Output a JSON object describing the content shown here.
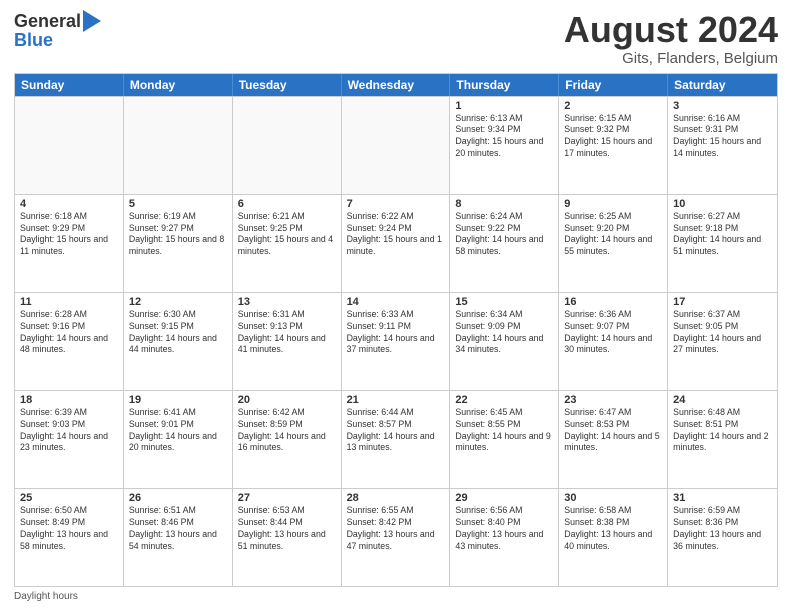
{
  "header": {
    "logo_general": "General",
    "logo_blue": "Blue",
    "title": "August 2024",
    "location": "Gits, Flanders, Belgium"
  },
  "days_of_week": [
    "Sunday",
    "Monday",
    "Tuesday",
    "Wednesday",
    "Thursday",
    "Friday",
    "Saturday"
  ],
  "footer": {
    "note": "Daylight hours"
  },
  "weeks": [
    [
      {
        "day": "",
        "empty": true
      },
      {
        "day": "",
        "empty": true
      },
      {
        "day": "",
        "empty": true
      },
      {
        "day": "",
        "empty": true
      },
      {
        "day": "1",
        "sunrise": "Sunrise: 6:13 AM",
        "sunset": "Sunset: 9:34 PM",
        "daylight": "Daylight: 15 hours and 20 minutes."
      },
      {
        "day": "2",
        "sunrise": "Sunrise: 6:15 AM",
        "sunset": "Sunset: 9:32 PM",
        "daylight": "Daylight: 15 hours and 17 minutes."
      },
      {
        "day": "3",
        "sunrise": "Sunrise: 6:16 AM",
        "sunset": "Sunset: 9:31 PM",
        "daylight": "Daylight: 15 hours and 14 minutes."
      }
    ],
    [
      {
        "day": "4",
        "sunrise": "Sunrise: 6:18 AM",
        "sunset": "Sunset: 9:29 PM",
        "daylight": "Daylight: 15 hours and 11 minutes."
      },
      {
        "day": "5",
        "sunrise": "Sunrise: 6:19 AM",
        "sunset": "Sunset: 9:27 PM",
        "daylight": "Daylight: 15 hours and 8 minutes."
      },
      {
        "day": "6",
        "sunrise": "Sunrise: 6:21 AM",
        "sunset": "Sunset: 9:25 PM",
        "daylight": "Daylight: 15 hours and 4 minutes."
      },
      {
        "day": "7",
        "sunrise": "Sunrise: 6:22 AM",
        "sunset": "Sunset: 9:24 PM",
        "daylight": "Daylight: 15 hours and 1 minute."
      },
      {
        "day": "8",
        "sunrise": "Sunrise: 6:24 AM",
        "sunset": "Sunset: 9:22 PM",
        "daylight": "Daylight: 14 hours and 58 minutes."
      },
      {
        "day": "9",
        "sunrise": "Sunrise: 6:25 AM",
        "sunset": "Sunset: 9:20 PM",
        "daylight": "Daylight: 14 hours and 55 minutes."
      },
      {
        "day": "10",
        "sunrise": "Sunrise: 6:27 AM",
        "sunset": "Sunset: 9:18 PM",
        "daylight": "Daylight: 14 hours and 51 minutes."
      }
    ],
    [
      {
        "day": "11",
        "sunrise": "Sunrise: 6:28 AM",
        "sunset": "Sunset: 9:16 PM",
        "daylight": "Daylight: 14 hours and 48 minutes."
      },
      {
        "day": "12",
        "sunrise": "Sunrise: 6:30 AM",
        "sunset": "Sunset: 9:15 PM",
        "daylight": "Daylight: 14 hours and 44 minutes."
      },
      {
        "day": "13",
        "sunrise": "Sunrise: 6:31 AM",
        "sunset": "Sunset: 9:13 PM",
        "daylight": "Daylight: 14 hours and 41 minutes."
      },
      {
        "day": "14",
        "sunrise": "Sunrise: 6:33 AM",
        "sunset": "Sunset: 9:11 PM",
        "daylight": "Daylight: 14 hours and 37 minutes."
      },
      {
        "day": "15",
        "sunrise": "Sunrise: 6:34 AM",
        "sunset": "Sunset: 9:09 PM",
        "daylight": "Daylight: 14 hours and 34 minutes."
      },
      {
        "day": "16",
        "sunrise": "Sunrise: 6:36 AM",
        "sunset": "Sunset: 9:07 PM",
        "daylight": "Daylight: 14 hours and 30 minutes."
      },
      {
        "day": "17",
        "sunrise": "Sunrise: 6:37 AM",
        "sunset": "Sunset: 9:05 PM",
        "daylight": "Daylight: 14 hours and 27 minutes."
      }
    ],
    [
      {
        "day": "18",
        "sunrise": "Sunrise: 6:39 AM",
        "sunset": "Sunset: 9:03 PM",
        "daylight": "Daylight: 14 hours and 23 minutes."
      },
      {
        "day": "19",
        "sunrise": "Sunrise: 6:41 AM",
        "sunset": "Sunset: 9:01 PM",
        "daylight": "Daylight: 14 hours and 20 minutes."
      },
      {
        "day": "20",
        "sunrise": "Sunrise: 6:42 AM",
        "sunset": "Sunset: 8:59 PM",
        "daylight": "Daylight: 14 hours and 16 minutes."
      },
      {
        "day": "21",
        "sunrise": "Sunrise: 6:44 AM",
        "sunset": "Sunset: 8:57 PM",
        "daylight": "Daylight: 14 hours and 13 minutes."
      },
      {
        "day": "22",
        "sunrise": "Sunrise: 6:45 AM",
        "sunset": "Sunset: 8:55 PM",
        "daylight": "Daylight: 14 hours and 9 minutes."
      },
      {
        "day": "23",
        "sunrise": "Sunrise: 6:47 AM",
        "sunset": "Sunset: 8:53 PM",
        "daylight": "Daylight: 14 hours and 5 minutes."
      },
      {
        "day": "24",
        "sunrise": "Sunrise: 6:48 AM",
        "sunset": "Sunset: 8:51 PM",
        "daylight": "Daylight: 14 hours and 2 minutes."
      }
    ],
    [
      {
        "day": "25",
        "sunrise": "Sunrise: 6:50 AM",
        "sunset": "Sunset: 8:49 PM",
        "daylight": "Daylight: 13 hours and 58 minutes."
      },
      {
        "day": "26",
        "sunrise": "Sunrise: 6:51 AM",
        "sunset": "Sunset: 8:46 PM",
        "daylight": "Daylight: 13 hours and 54 minutes."
      },
      {
        "day": "27",
        "sunrise": "Sunrise: 6:53 AM",
        "sunset": "Sunset: 8:44 PM",
        "daylight": "Daylight: 13 hours and 51 minutes."
      },
      {
        "day": "28",
        "sunrise": "Sunrise: 6:55 AM",
        "sunset": "Sunset: 8:42 PM",
        "daylight": "Daylight: 13 hours and 47 minutes."
      },
      {
        "day": "29",
        "sunrise": "Sunrise: 6:56 AM",
        "sunset": "Sunset: 8:40 PM",
        "daylight": "Daylight: 13 hours and 43 minutes."
      },
      {
        "day": "30",
        "sunrise": "Sunrise: 6:58 AM",
        "sunset": "Sunset: 8:38 PM",
        "daylight": "Daylight: 13 hours and 40 minutes."
      },
      {
        "day": "31",
        "sunrise": "Sunrise: 6:59 AM",
        "sunset": "Sunset: 8:36 PM",
        "daylight": "Daylight: 13 hours and 36 minutes."
      }
    ]
  ]
}
